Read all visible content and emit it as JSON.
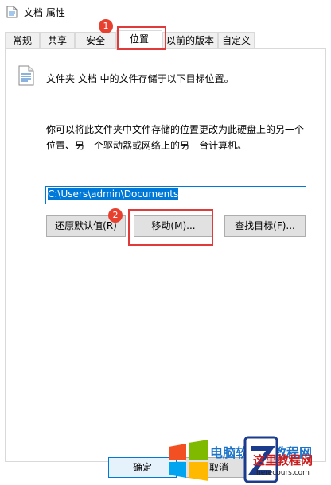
{
  "window": {
    "title": "文档 属性"
  },
  "tabs": [
    {
      "label": "常规"
    },
    {
      "label": "共享"
    },
    {
      "label": "安全"
    },
    {
      "label": "位置"
    },
    {
      "label": "以前的版本"
    },
    {
      "label": "自定义"
    }
  ],
  "location": {
    "description": "文件夹 文档 中的文件存储于以下目标位置。",
    "explanation": "你可以将此文件夹中文件存储的位置更改为此硬盘上的另一个位置、另一个驱动器或网络上的另一台计算机。",
    "path_value": "C:\\Users\\admin\\Documents"
  },
  "buttons": {
    "restore_default": "还原默认值(R)",
    "move": "移动(M)...",
    "find_target": "查找目标(F)...",
    "ok": "确定",
    "cancel": "取消"
  },
  "annotations": {
    "step1": "1",
    "step2": "2"
  },
  "watermark": {
    "text": "电脑软硬件教程网",
    "brand": "这里教程网",
    "url": "herecours.com"
  },
  "colors": {
    "accent": "#0078d7",
    "annotation_red": "#e03b3b"
  }
}
